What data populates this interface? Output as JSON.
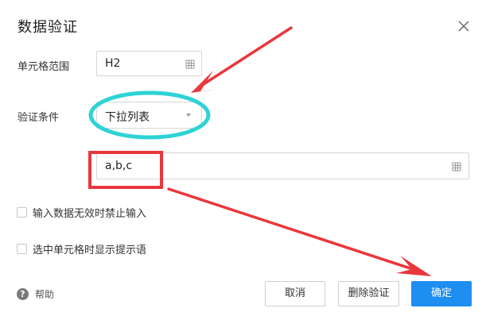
{
  "dialog": {
    "title": "数据验证",
    "close_icon": "close-icon"
  },
  "range": {
    "label": "单元格范围",
    "value": "H2",
    "icon": "grid-icon"
  },
  "condition": {
    "label": "验证条件",
    "selected": "下拉列表",
    "icon": "chevron-down-icon"
  },
  "source": {
    "value": "a,b,c",
    "icon": "grid-icon"
  },
  "options": [
    {
      "label": "输入数据无效时禁止输入",
      "checked": false
    },
    {
      "label": "选中单元格时显示提示语",
      "checked": false
    }
  ],
  "footer": {
    "help_label": "帮助",
    "help_icon": "question-circle-icon",
    "cancel_label": "取消",
    "delete_label": "删除验证",
    "confirm_label": "确定"
  },
  "colors": {
    "primary": "#1f8ef1",
    "annotation_red": "#e8383d",
    "annotation_cyan": "#2ed3d6"
  }
}
